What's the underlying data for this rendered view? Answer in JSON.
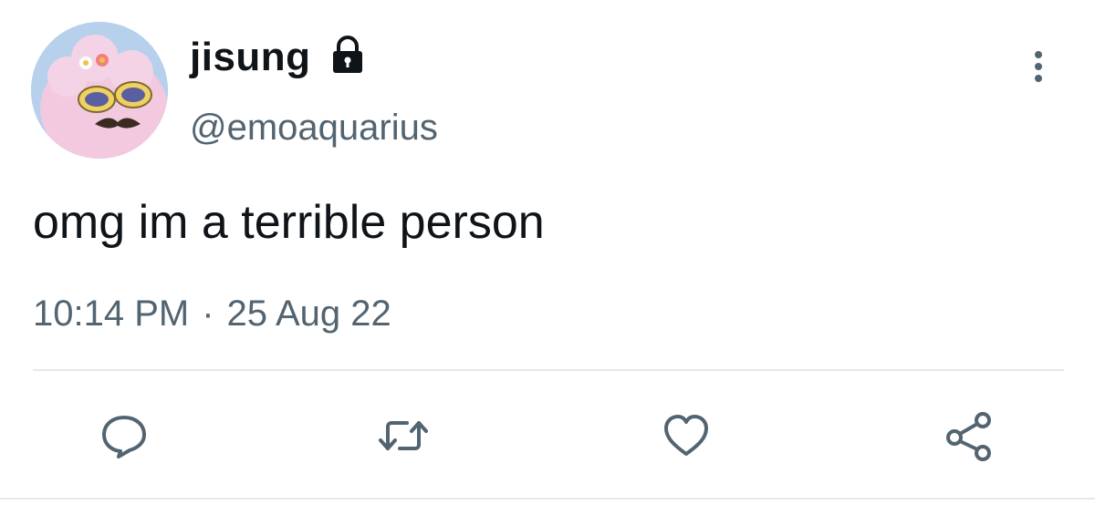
{
  "tweet": {
    "author": {
      "display_name": "jisung",
      "handle": "@emoaquarius",
      "protected_icon": "lock-icon",
      "avatar": "avatar"
    },
    "text": "omg im a terrible person",
    "time": "10:14 PM",
    "separator": "·",
    "date": "25 Aug 22"
  },
  "actions": {
    "reply": "reply-icon",
    "retweet": "retweet-icon",
    "like": "heart-icon",
    "share": "share-icon",
    "more": "more-vertical-icon"
  },
  "colors": {
    "text_primary": "#0f1419",
    "text_secondary": "#536471",
    "icon": "#536471",
    "divider": "#e6e9ec"
  }
}
